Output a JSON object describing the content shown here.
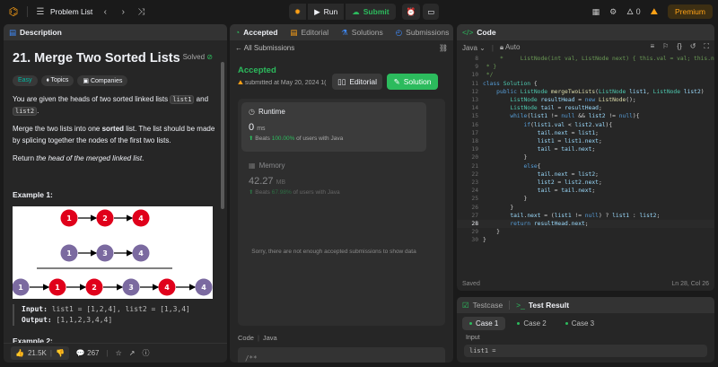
{
  "topbar": {
    "problem_list": "Problem List",
    "run": "Run",
    "submit": "Submit",
    "streak": "0",
    "premium": "Premium"
  },
  "description": {
    "tab_label": "Description",
    "title": "21. Merge Two Sorted Lists",
    "solved": "Solved",
    "tags": [
      "Easy",
      "Topics",
      "Companies"
    ],
    "para1_pre": "You are given the heads of two sorted linked lists ",
    "para1_code1": "list1",
    "para1_mid": " and ",
    "para1_code2": "list2",
    "para1_post": ".",
    "para2_pre": "Merge the two lists into one ",
    "para2_bold": "sorted",
    "para2_post": " list. The list should be made by splicing together the nodes of the first two lists.",
    "para3_pre": "Return ",
    "para3_em": "the head of the merged linked list",
    "para3_post": ".",
    "example1_heading": "Example 1:",
    "example1_input_label": "Input:",
    "example1_input": "list1 = [1,2,4], list2 = [1,3,4]",
    "example1_output_label": "Output:",
    "example1_output": "[1,1,2,3,4,4]",
    "example2_heading": "Example 2:",
    "likes": "21.5K",
    "comments": "267",
    "diagram": {
      "row1": [
        "1",
        "2",
        "4"
      ],
      "row2": [
        "1",
        "3",
        "4"
      ],
      "row3": [
        "1",
        "1",
        "2",
        "3",
        "4",
        "4"
      ]
    }
  },
  "submission": {
    "tabs": [
      "Accepted",
      "Editorial",
      "Solutions",
      "Submissions"
    ],
    "all_submissions": "All Submissions",
    "status": "Accepted",
    "submitted_at": "submitted at May 20, 2024 1(",
    "editorial_button": "Editorial",
    "solution_button": "Solution",
    "runtime_label": "Runtime",
    "runtime_value": "0",
    "runtime_unit": "ms",
    "runtime_beats_pre": "Beats ",
    "runtime_beats_pct": "100.00%",
    "runtime_beats_post": " of users with Java",
    "memory_label": "Memory",
    "memory_value": "42.27",
    "memory_unit": "MB",
    "memory_beats_pre": "Beats ",
    "memory_beats_pct": "67.98%",
    "memory_beats_post": " of users with Java",
    "not_enough": "Sorry, there are not enough accepted submissions to show data",
    "code_label": "Code",
    "code_lang": "Java",
    "code_preview": "/**"
  },
  "code": {
    "tab_label": "Code",
    "language": "Java",
    "auto": "Auto",
    "status_saved": "Saved",
    "cursor_pos": "Ln 28, Col 26",
    "current_line": 28,
    "line_numbers": [
      8,
      9,
      10,
      11,
      12,
      13,
      14,
      15,
      16,
      17,
      18,
      19,
      20,
      21,
      22,
      23,
      24,
      25,
      26,
      27,
      28,
      29,
      30
    ]
  },
  "tests": {
    "testcase_tab": "Testcase",
    "result_tab": "Test Result",
    "cases": [
      "Case 1",
      "Case 2",
      "Case 3"
    ],
    "input_label": "Input",
    "input_value": "list1 ="
  },
  "colors": {
    "accent": "#ffa116",
    "green": "#2cbb5d",
    "red_node": "#e0001b",
    "purple_node": "#7b6aa0"
  }
}
